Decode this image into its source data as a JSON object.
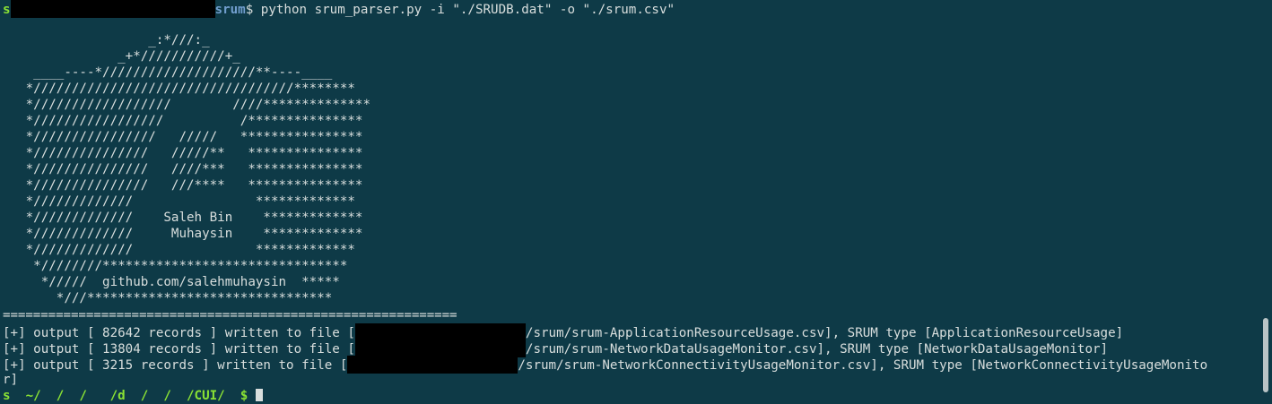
{
  "terminal": {
    "prompt": {
      "user_hidden_start": "s",
      "cwd_suffix": "srum",
      "symbol": "$",
      "command": " python srum_parser.py -i \"./SRUDB.dat\" -o \"./srum.csv\""
    },
    "banner_lines": [
      "                   _:*///:_",
      "               _+*///////////+_",
      "    ____----*////////////////////**----____",
      "   *//////////////////////////////////********",
      "   *//////////////////        ////**************",
      "   */////////////////          /***************",
      "   *////////////////   /////   ****************",
      "   *///////////////   /////**   ***************",
      "   *///////////////   ////***   ***************",
      "   *///////////////   ///****   ***************",
      "   */////////////                *************",
      "   */////////////    Saleh Bin    *************",
      "   */////////////     Muhaysin    *************",
      "   */////////////                *************",
      "    *////////********************************",
      "     */////  github.com/salehmuhaysin  *****",
      "       *///********************************"
    ],
    "separator": "============================================================",
    "outputs": [
      {
        "prefix": "[+] output [ 82642 records ] written to file [",
        "suffix": "/srum/srum-ApplicationResourceUsage.csv], SRUM type [ApplicationResourceUsage]"
      },
      {
        "prefix": "[+] output [ 13804 records ] written to file [",
        "suffix": "/srum/srum-NetworkDataUsageMonitor.csv], SRUM type [NetworkDataUsageMonitor]"
      },
      {
        "prefix": "[+] output [ 3215 records ] written to file [",
        "suffix": "/srum/srum-NetworkConnectivityUsageMonitor.csv], SRUM type [NetworkConnectivityUsageMonito"
      }
    ],
    "wrap_tail": "r]",
    "last_prompt_partial": "s  ~/  /  /   /d  /  /  /CUI/  $"
  },
  "colors": {
    "background": "#0e3a47",
    "text": "#d8dedd",
    "prompt_user": "#8ae234",
    "prompt_path": "#729fcf",
    "redaction": "#000000"
  }
}
